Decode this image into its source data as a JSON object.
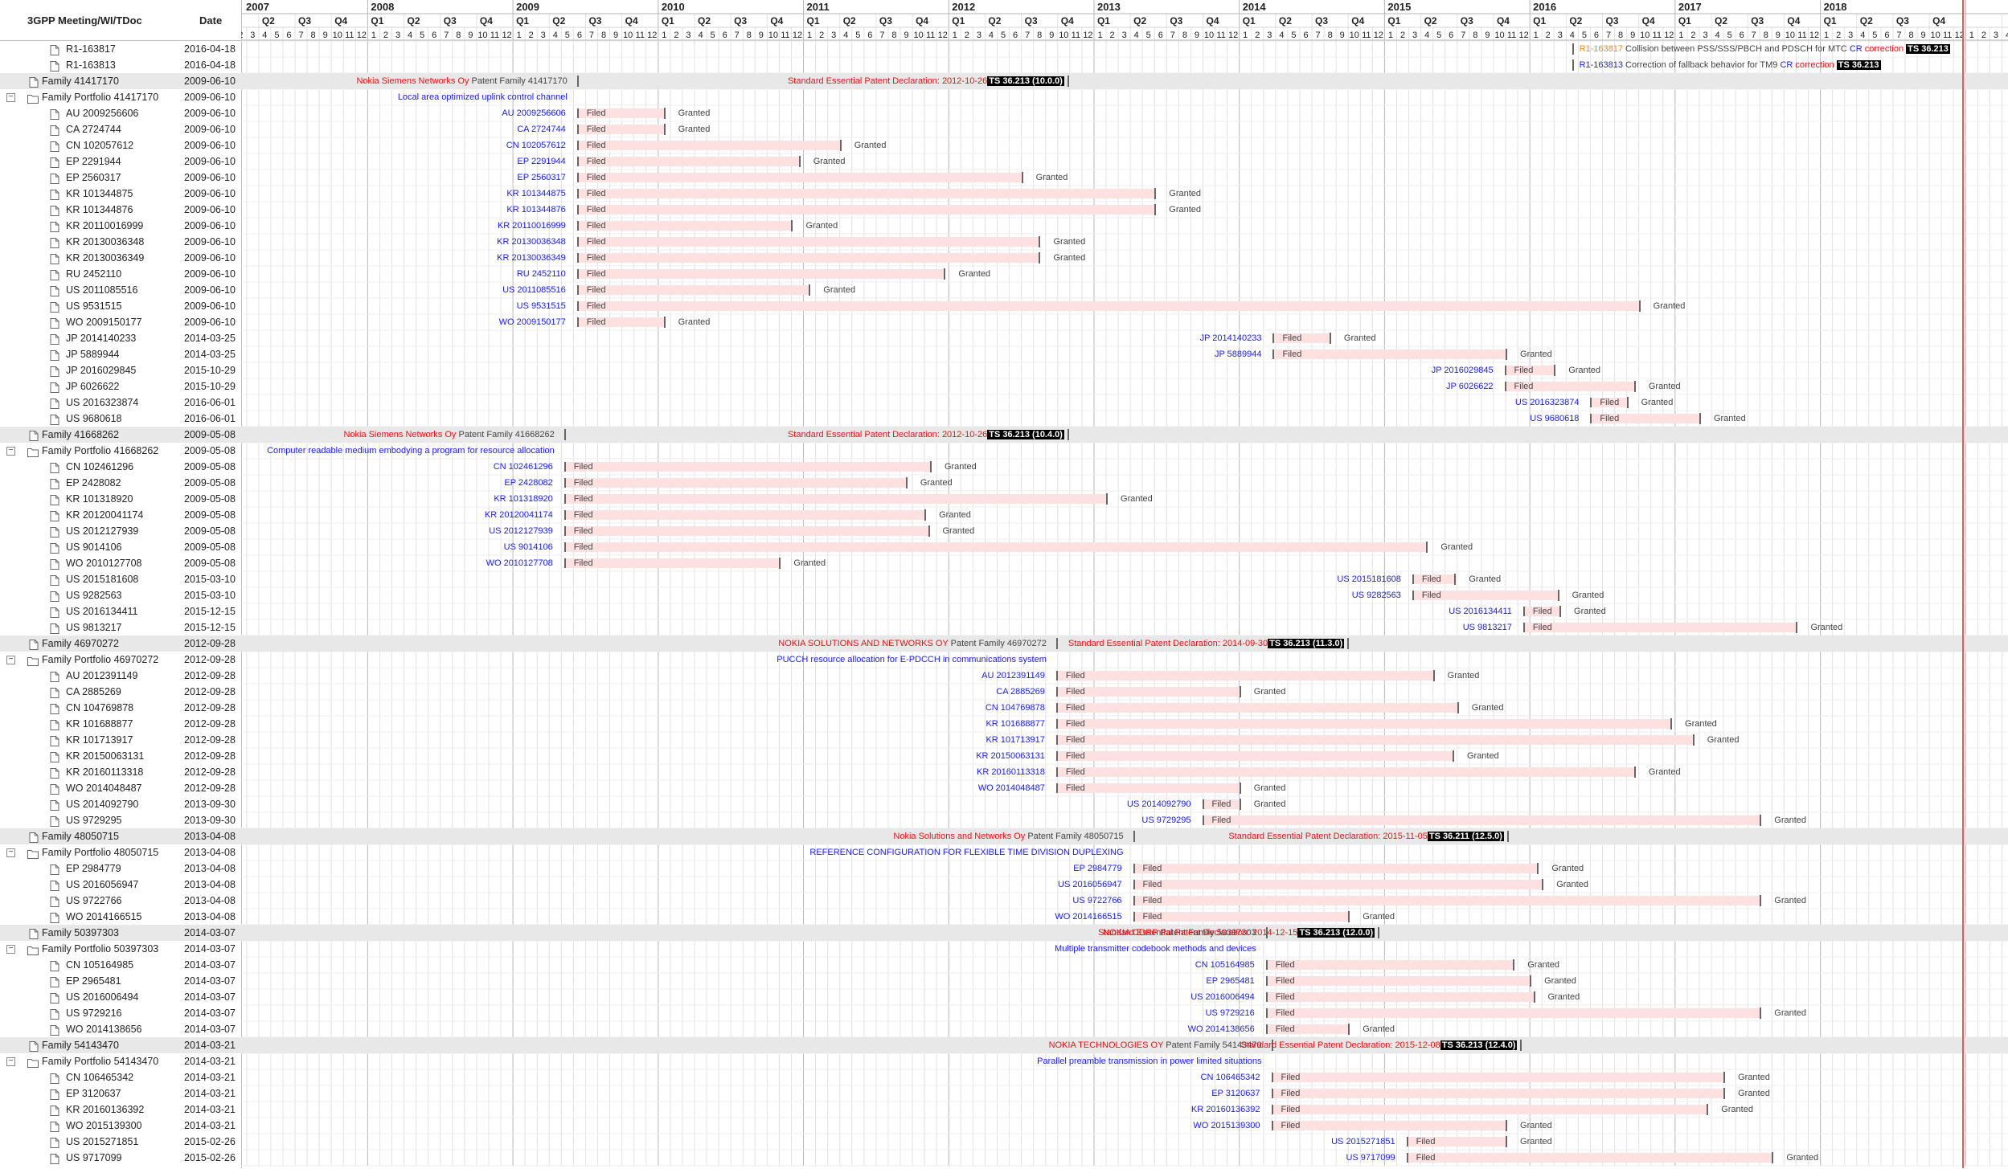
{
  "header": {
    "col_name": "3GPP Meeting/WI/TDoc",
    "col_date": "Date"
  },
  "years": [
    "2007",
    "2008",
    "2009",
    "2010",
    "2011",
    "2012",
    "2013",
    "2014",
    "2015",
    "2016",
    "2017",
    "2018"
  ],
  "quarter_labels": [
    "Q1",
    "Q2",
    "Q3",
    "Q4"
  ],
  "rows": [
    {
      "type": "doc",
      "name": "R1-163817",
      "date": "2016-04-18"
    },
    {
      "type": "doc",
      "name": "R1-163813",
      "date": "2016-04-18"
    },
    {
      "type": "family",
      "name": "Family 41417170",
      "date": "2009-06-10"
    },
    {
      "type": "portfolio",
      "name": "Family Portfolio 41417170",
      "date": "2009-06-10"
    },
    {
      "type": "patent",
      "name": "AU 2009256606",
      "date": "2009-06-10"
    },
    {
      "type": "patent",
      "name": "CA 2724744",
      "date": "2009-06-10"
    },
    {
      "type": "patent",
      "name": "CN 102057612",
      "date": "2009-06-10"
    },
    {
      "type": "patent",
      "name": "EP 2291944",
      "date": "2009-06-10"
    },
    {
      "type": "patent",
      "name": "EP 2560317",
      "date": "2009-06-10"
    },
    {
      "type": "patent",
      "name": "KR 101344875",
      "date": "2009-06-10"
    },
    {
      "type": "patent",
      "name": "KR 101344876",
      "date": "2009-06-10"
    },
    {
      "type": "patent",
      "name": "KR 20110016999",
      "date": "2009-06-10"
    },
    {
      "type": "patent",
      "name": "KR 20130036348",
      "date": "2009-06-10"
    },
    {
      "type": "patent",
      "name": "KR 20130036349",
      "date": "2009-06-10"
    },
    {
      "type": "patent",
      "name": "RU 2452110",
      "date": "2009-06-10"
    },
    {
      "type": "patent",
      "name": "US 2011085516",
      "date": "2009-06-10"
    },
    {
      "type": "patent",
      "name": "US 9531515",
      "date": "2009-06-10"
    },
    {
      "type": "patent",
      "name": "WO 2009150177",
      "date": "2009-06-10"
    },
    {
      "type": "patent",
      "name": "JP 2014140233",
      "date": "2014-03-25"
    },
    {
      "type": "patent",
      "name": "JP 5889944",
      "date": "2014-03-25"
    },
    {
      "type": "patent",
      "name": "JP 2016029845",
      "date": "2015-10-29"
    },
    {
      "type": "patent",
      "name": "JP 6026622",
      "date": "2015-10-29"
    },
    {
      "type": "patent",
      "name": "US 2016323874",
      "date": "2016-06-01"
    },
    {
      "type": "patent",
      "name": "US 9680618",
      "date": "2016-06-01"
    },
    {
      "type": "family",
      "name": "Family 41668262",
      "date": "2009-05-08"
    },
    {
      "type": "portfolio",
      "name": "Family Portfolio 41668262",
      "date": "2009-05-08"
    },
    {
      "type": "patent",
      "name": "CN 102461296",
      "date": "2009-05-08"
    },
    {
      "type": "patent",
      "name": "EP 2428082",
      "date": "2009-05-08"
    },
    {
      "type": "patent",
      "name": "KR 101318920",
      "date": "2009-05-08"
    },
    {
      "type": "patent",
      "name": "KR 20120041174",
      "date": "2009-05-08"
    },
    {
      "type": "patent",
      "name": "US 2012127939",
      "date": "2009-05-08"
    },
    {
      "type": "patent",
      "name": "US 9014106",
      "date": "2009-05-08"
    },
    {
      "type": "patent",
      "name": "WO 2010127708",
      "date": "2009-05-08"
    },
    {
      "type": "patent",
      "name": "US 2015181608",
      "date": "2015-03-10"
    },
    {
      "type": "patent",
      "name": "US 9282563",
      "date": "2015-03-10"
    },
    {
      "type": "patent",
      "name": "US 2016134411",
      "date": "2015-12-15"
    },
    {
      "type": "patent",
      "name": "US 9813217",
      "date": "2015-12-15"
    },
    {
      "type": "family",
      "name": "Family 46970272",
      "date": "2012-09-28"
    },
    {
      "type": "portfolio",
      "name": "Family Portfolio 46970272",
      "date": "2012-09-28"
    },
    {
      "type": "patent",
      "name": "AU 2012391149",
      "date": "2012-09-28"
    },
    {
      "type": "patent",
      "name": "CA 2885269",
      "date": "2012-09-28"
    },
    {
      "type": "patent",
      "name": "CN 104769878",
      "date": "2012-09-28"
    },
    {
      "type": "patent",
      "name": "KR 101688877",
      "date": "2012-09-28"
    },
    {
      "type": "patent",
      "name": "KR 101713917",
      "date": "2012-09-28"
    },
    {
      "type": "patent",
      "name": "KR 20150063131",
      "date": "2012-09-28"
    },
    {
      "type": "patent",
      "name": "KR 20160113318",
      "date": "2012-09-28"
    },
    {
      "type": "patent",
      "name": "WO 2014048487",
      "date": "2012-09-28"
    },
    {
      "type": "patent",
      "name": "US 2014092790",
      "date": "2013-09-30"
    },
    {
      "type": "patent",
      "name": "US 9729295",
      "date": "2013-09-30"
    },
    {
      "type": "family",
      "name": "Family 48050715",
      "date": "2013-04-08"
    },
    {
      "type": "portfolio",
      "name": "Family Portfolio 48050715",
      "date": "2013-04-08"
    },
    {
      "type": "patent",
      "name": "EP 2984779",
      "date": "2013-04-08"
    },
    {
      "type": "patent",
      "name": "US 2016056947",
      "date": "2013-04-08"
    },
    {
      "type": "patent",
      "name": "US 9722766",
      "date": "2013-04-08"
    },
    {
      "type": "patent",
      "name": "WO 2014166515",
      "date": "2013-04-08"
    },
    {
      "type": "family",
      "name": "Family 50397303",
      "date": "2014-03-07"
    },
    {
      "type": "portfolio",
      "name": "Family Portfolio 50397303",
      "date": "2014-03-07"
    },
    {
      "type": "patent",
      "name": "CN 105164985",
      "date": "2014-03-07"
    },
    {
      "type": "patent",
      "name": "EP 2965481",
      "date": "2014-03-07"
    },
    {
      "type": "patent",
      "name": "US 2016006494",
      "date": "2014-03-07"
    },
    {
      "type": "patent",
      "name": "US 9729216",
      "date": "2014-03-07"
    },
    {
      "type": "patent",
      "name": "WO 2014138656",
      "date": "2014-03-07"
    },
    {
      "type": "family",
      "name": "Family 54143470",
      "date": "2014-03-21"
    },
    {
      "type": "portfolio",
      "name": "Family Portfolio 54143470",
      "date": "2014-03-21"
    },
    {
      "type": "patent",
      "name": "CN 106465342",
      "date": "2014-03-21"
    },
    {
      "type": "patent",
      "name": "EP 3120637",
      "date": "2014-03-21"
    },
    {
      "type": "patent",
      "name": "KR 20160136392",
      "date": "2014-03-21"
    },
    {
      "type": "patent",
      "name": "WO 2015139300",
      "date": "2014-03-21"
    },
    {
      "type": "patent",
      "name": "US 2015271851",
      "date": "2015-02-26"
    },
    {
      "type": "patent",
      "name": "US 9717099",
      "date": "2015-02-26"
    }
  ],
  "doc_entries": [
    {
      "row": 0,
      "date": "2016-04-18",
      "id": "R1-163817",
      "id_color": "orange",
      "text": "Collision between PSS/SSS/PBCH and PDSCH for MTC",
      "cr": "CR",
      "correction": "correction",
      "ts": "TS 36.213"
    },
    {
      "row": 1,
      "date": "2016-04-18",
      "id": "R1-163813",
      "id_color": "blue",
      "text": "Correction of fallback behavior for TM9",
      "cr": "CR",
      "correction": "correction",
      "ts": "TS 36.213"
    }
  ],
  "families": [
    {
      "row": 2,
      "date": "2009-06-10",
      "owner": "Nokia Siemens Networks Oy",
      "suffix": "Patent Family 41417170",
      "decl_date": "2012-10-26",
      "decl": "Standard Essential Patent Declaration: 2012-10-26",
      "ts": "TS 36.213 (10.0.0)"
    },
    {
      "row": 24,
      "date": "2009-05-08",
      "owner": "Nokia Siemens Networks Oy",
      "suffix": "Patent Family 41668262",
      "decl_date": "2012-10-26",
      "decl": "Standard Essential Patent Declaration: 2012-10-26",
      "ts": "TS 36.213 (10.4.0)"
    },
    {
      "row": 37,
      "date": "2012-09-28",
      "owner": "NOKIA SOLUTIONS AND NETWORKS OY",
      "suffix": "Patent Family 46970272",
      "decl_date": "2014-09-30",
      "decl": "Standard Essential Patent Declaration: 2014-09-30",
      "ts": "TS 36.213 (11.3.0)"
    },
    {
      "row": 49,
      "date": "2013-04-08",
      "owner": "Nokia Solutions and Networks Oy",
      "suffix": "Patent Family 48050715",
      "decl_date": "2015-11-05",
      "decl": "Standard Essential Patent Declaration: 2015-11-05",
      "ts": "TS 36.211 (12.5.0)"
    },
    {
      "row": 55,
      "date": "2014-03-07",
      "owner": "NOKIA CORP",
      "suffix": "Patent Family 50397303",
      "decl_date": "2014-12-15",
      "decl": "Standard Essential Patent Declaration: 2014-12-15",
      "ts": "TS 36.213 (12.0.0)"
    },
    {
      "row": 62,
      "date": "2014-03-21",
      "owner": "NOKIA TECHNOLOGIES OY",
      "suffix": "Patent Family 54143470",
      "decl_date": "2015-12-08",
      "decl": "Standard Essential Patent Declaration: 2015-12-08",
      "ts": "TS 36.213 (12.4.0)"
    }
  ],
  "portfolios": [
    {
      "row": 3,
      "date": "2009-06-10",
      "title": "Local area optimized uplink control channel"
    },
    {
      "row": 25,
      "date": "2009-05-08",
      "title": "Computer readable medium embodying a program for resource allocation"
    },
    {
      "row": 38,
      "date": "2012-09-28",
      "title": "PUCCH resource allocation for E-PDCCH in communications system"
    },
    {
      "row": 50,
      "date": "2013-04-08",
      "title": "REFERENCE CONFIGURATION FOR FLEXIBLE TIME DIVISION DUPLEXING"
    },
    {
      "row": 56,
      "date": "2014-03-07",
      "title": "Multiple transmitter codebook methods and devices"
    },
    {
      "row": 63,
      "date": "2014-03-21",
      "title": "Parallel preamble transmission in power limited situations"
    }
  ],
  "patents": [
    {
      "row": 4,
      "label": "AU 2009256606",
      "filed": "2009-06-10",
      "granted": "2010-01-15"
    },
    {
      "row": 5,
      "label": "CA 2724744",
      "filed": "2009-06-10",
      "granted": "2010-01-15"
    },
    {
      "row": 6,
      "label": "CN 102057612",
      "filed": "2009-06-10",
      "granted": "2011-04-01"
    },
    {
      "row": 7,
      "label": "EP 2291944",
      "filed": "2009-06-10",
      "granted": "2010-12-20"
    },
    {
      "row": 8,
      "label": "EP 2560317",
      "filed": "2009-06-10",
      "granted": "2012-07-01"
    },
    {
      "row": 9,
      "label": "KR 101344875",
      "filed": "2009-06-10",
      "granted": "2013-06-01"
    },
    {
      "row": 10,
      "label": "KR 101344876",
      "filed": "2009-06-10",
      "granted": "2013-06-01"
    },
    {
      "row": 11,
      "label": "KR 20110016999",
      "filed": "2009-06-10",
      "granted": "2010-12-01"
    },
    {
      "row": 12,
      "label": "KR 20130036348",
      "filed": "2009-06-10",
      "granted": "2012-08-15"
    },
    {
      "row": 13,
      "label": "KR 20130036349",
      "filed": "2009-06-10",
      "granted": "2012-08-15"
    },
    {
      "row": 14,
      "label": "RU 2452110",
      "filed": "2009-06-10",
      "granted": "2011-12-20"
    },
    {
      "row": 15,
      "label": "US 2011085516",
      "filed": "2009-06-10",
      "granted": "2011-01-15"
    },
    {
      "row": 16,
      "label": "US 9531515",
      "filed": "2009-06-10",
      "granted": "2016-10-01"
    },
    {
      "row": 17,
      "label": "WO 2009150177",
      "filed": "2009-06-10",
      "granted": "2010-01-15"
    },
    {
      "row": 18,
      "label": "JP 2014140233",
      "filed": "2014-03-25",
      "granted": "2014-08-15"
    },
    {
      "row": 19,
      "label": "JP 5889944",
      "filed": "2014-03-25",
      "granted": "2015-11-01"
    },
    {
      "row": 20,
      "label": "JP 2016029845",
      "filed": "2015-10-29",
      "granted": "2016-03-01"
    },
    {
      "row": 21,
      "label": "JP 6026622",
      "filed": "2015-10-29",
      "granted": "2016-09-20"
    },
    {
      "row": 22,
      "label": "US 2016323874",
      "filed": "2016-06-01",
      "granted": "2016-09-01"
    },
    {
      "row": 23,
      "label": "US 9680618",
      "filed": "2016-06-01",
      "granted": "2017-03-01"
    },
    {
      "row": 26,
      "label": "CN 102461296",
      "filed": "2009-05-08",
      "granted": "2011-11-15"
    },
    {
      "row": 27,
      "label": "EP 2428082",
      "filed": "2009-05-08",
      "granted": "2011-09-15"
    },
    {
      "row": 28,
      "label": "KR 101318920",
      "filed": "2009-05-08",
      "granted": "2013-02-01"
    },
    {
      "row": 29,
      "label": "KR 20120041174",
      "filed": "2009-05-08",
      "granted": "2011-11-01"
    },
    {
      "row": 30,
      "label": "US 2012127939",
      "filed": "2009-05-08",
      "granted": "2011-11-10"
    },
    {
      "row": 31,
      "label": "US 9014106",
      "filed": "2009-05-08",
      "granted": "2015-04-15"
    },
    {
      "row": 32,
      "label": "WO 2010127708",
      "filed": "2009-05-08",
      "granted": "2010-11-01"
    },
    {
      "row": 33,
      "label": "US 2015181608",
      "filed": "2015-03-10",
      "granted": "2015-06-25"
    },
    {
      "row": 34,
      "label": "US 9282563",
      "filed": "2015-03-10",
      "granted": "2016-03-10"
    },
    {
      "row": 35,
      "label": "US 2016134411",
      "filed": "2015-12-15",
      "granted": "2016-03-15"
    },
    {
      "row": 36,
      "label": "US 9813217",
      "filed": "2015-12-15",
      "granted": "2017-11-01"
    },
    {
      "row": 39,
      "label": "AU 2012391149",
      "filed": "2012-09-28",
      "granted": "2015-05-01"
    },
    {
      "row": 40,
      "label": "CA 2885269",
      "filed": "2012-09-28",
      "granted": "2014-01-01"
    },
    {
      "row": 41,
      "label": "CN 104769878",
      "filed": "2012-09-28",
      "granted": "2015-07-01"
    },
    {
      "row": 42,
      "label": "KR 101688877",
      "filed": "2012-09-28",
      "granted": "2016-12-20"
    },
    {
      "row": 43,
      "label": "KR 101713917",
      "filed": "2012-09-28",
      "granted": "2017-02-15"
    },
    {
      "row": 44,
      "label": "KR 20150063131",
      "filed": "2012-09-28",
      "granted": "2015-06-20"
    },
    {
      "row": 45,
      "label": "KR 20160113318",
      "filed": "2012-09-28",
      "granted": "2016-09-20"
    },
    {
      "row": 46,
      "label": "WO 2014048487",
      "filed": "2012-09-28",
      "granted": "2014-01-01"
    },
    {
      "row": 47,
      "label": "US 2014092790",
      "filed": "2013-09-30",
      "granted": "2014-01-01"
    },
    {
      "row": 48,
      "label": "US 9729295",
      "filed": "2013-09-30",
      "granted": "2017-08-01"
    },
    {
      "row": 51,
      "label": "EP 2984779",
      "filed": "2013-04-08",
      "granted": "2016-01-20"
    },
    {
      "row": 52,
      "label": "US 2016056947",
      "filed": "2013-04-08",
      "granted": "2016-02-01"
    },
    {
      "row": 53,
      "label": "US 9722766",
      "filed": "2013-04-08",
      "granted": "2017-08-01"
    },
    {
      "row": 54,
      "label": "WO 2014166515",
      "filed": "2013-04-08",
      "granted": "2014-10-01"
    },
    {
      "row": 57,
      "label": "CN 105164985",
      "filed": "2014-03-07",
      "granted": "2015-11-20"
    },
    {
      "row": 58,
      "label": "EP 2965481",
      "filed": "2014-03-07",
      "granted": "2016-01-01"
    },
    {
      "row": 59,
      "label": "US 2016006494",
      "filed": "2014-03-07",
      "granted": "2016-01-10"
    },
    {
      "row": 60,
      "label": "US 9729216",
      "filed": "2014-03-07",
      "granted": "2017-08-01"
    },
    {
      "row": 61,
      "label": "WO 2014138656",
      "filed": "2014-03-07",
      "granted": "2014-10-01"
    },
    {
      "row": 64,
      "label": "CN 106465342",
      "filed": "2014-03-21",
      "granted": "2017-05-01"
    },
    {
      "row": 65,
      "label": "EP 3120637",
      "filed": "2014-03-21",
      "granted": "2017-05-01"
    },
    {
      "row": 66,
      "label": "KR 20160136392",
      "filed": "2014-03-21",
      "granted": "2017-03-20"
    },
    {
      "row": 67,
      "label": "WO 2015139300",
      "filed": "2014-03-21",
      "granted": "2015-11-01"
    },
    {
      "row": 68,
      "label": "US 2015271851",
      "filed": "2015-02-26",
      "granted": "2015-11-01"
    },
    {
      "row": 69,
      "label": "US 9717099",
      "filed": "2015-02-26",
      "granted": "2017-09-01"
    }
  ],
  "status": {
    "filed": "Filed",
    "granted": "Granted"
  },
  "colors": {
    "blue": "#1a1aff",
    "orange": "#ff8800",
    "red": "#ee1111",
    "bar": "#fde0e0",
    "today": "#e35b5b",
    "family_bg": "#e8e8e8"
  },
  "icons": {
    "doc": "document-icon",
    "folder": "folder-icon",
    "toggle": "collapse-toggle-icon"
  }
}
